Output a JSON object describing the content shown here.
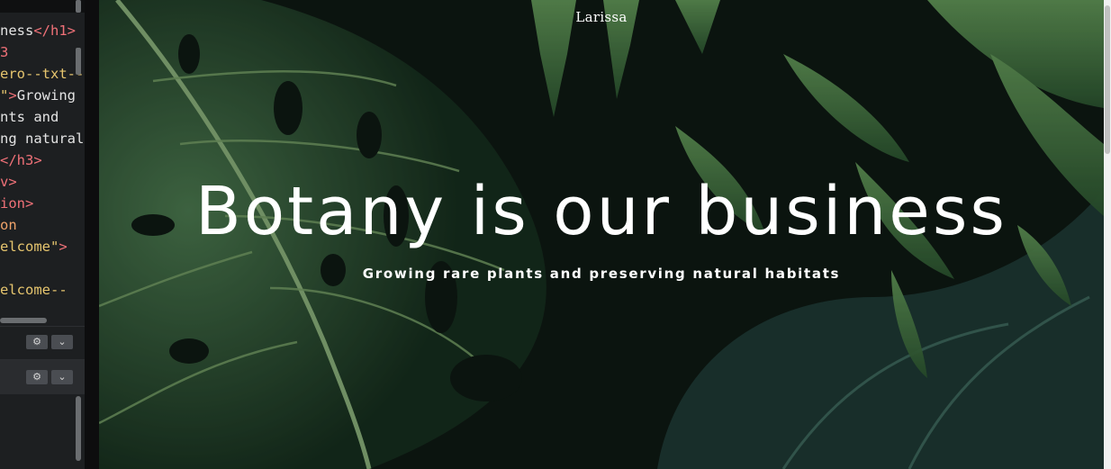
{
  "editor": {
    "html_lines": [
      {
        "parts": [
          {
            "t": "ness",
            "c": "txt"
          },
          {
            "t": "</h1>",
            "c": "tag"
          }
        ]
      },
      {
        "parts": [
          {
            "t": "3",
            "c": "tag"
          }
        ]
      },
      {
        "parts": [
          {
            "t": "ero--txt--",
            "c": "str"
          }
        ]
      },
      {
        "parts": [
          {
            "t": "\"",
            "c": "str"
          },
          {
            "t": ">",
            "c": "tag"
          },
          {
            "t": "Growing",
            "c": "txt"
          }
        ]
      },
      {
        "parts": [
          {
            "t": "nts and",
            "c": "txt"
          }
        ]
      },
      {
        "parts": [
          {
            "t": "ng natural",
            "c": "txt"
          }
        ]
      },
      {
        "parts": [
          {
            "t": "</h3>",
            "c": "tag"
          }
        ]
      },
      {
        "parts": [
          {
            "t": "v>",
            "c": "tag"
          }
        ]
      },
      {
        "parts": [
          {
            "t": "ion>",
            "c": "tag"
          }
        ]
      },
      {
        "parts": [
          {
            "t": "on",
            "c": "attr"
          }
        ]
      },
      {
        "parts": [
          {
            "t": "elcome\"",
            "c": "str"
          },
          {
            "t": ">",
            "c": "tag"
          }
        ]
      },
      {
        "parts": []
      },
      {
        "parts": [
          {
            "t": "elcome--",
            "c": "str"
          }
        ]
      }
    ],
    "css_panel": {
      "gear": "⚙",
      "chevron": "⌄"
    },
    "js_panel": {
      "gear": "⚙",
      "chevron": "⌄"
    }
  },
  "preview": {
    "logo": "Larissa",
    "title": "Botany is our business",
    "subtitle": "Growing rare plants and preserving natural habitats"
  },
  "colors": {
    "tag": "#f07178",
    "attr": "#f0a36a",
    "string": "#e6c56e",
    "text": "#e3e3e3",
    "leaf_dark": "#1f4a2e",
    "leaf_light": "#4f8a4a"
  }
}
